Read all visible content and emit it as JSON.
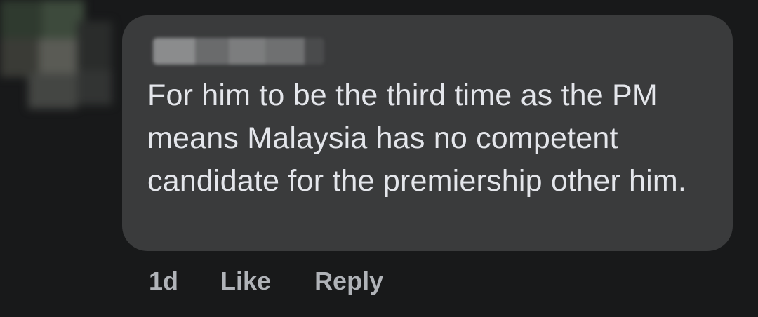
{
  "comment": {
    "text": "For him to be the third time as the PM means Malaysia has no competent candidate for the premiership other him.",
    "colors": {
      "background": "#18191a",
      "bubble": "#3a3b3c",
      "text": "#e4e6eb",
      "meta": "#b0b3b8"
    }
  },
  "actions": {
    "timestamp": "1d",
    "like_label": "Like",
    "reply_label": "Reply"
  }
}
